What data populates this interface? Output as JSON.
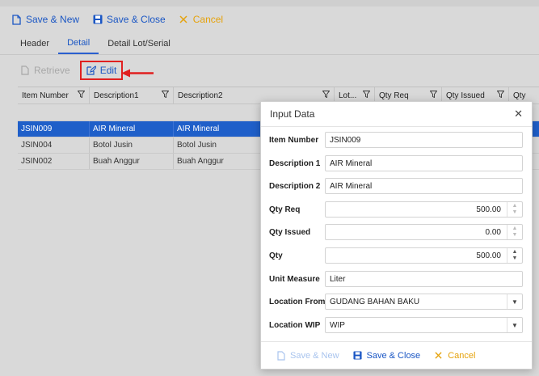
{
  "toolbar": {
    "save_new": "Save & New",
    "save_close": "Save & Close",
    "cancel": "Cancel"
  },
  "tabs": [
    "Header",
    "Detail",
    "Detail Lot/Serial"
  ],
  "subtoolbar": {
    "retrieve": "Retrieve",
    "edit": "Edit"
  },
  "grid": {
    "columns": [
      "Item Number",
      "Description1",
      "Description2",
      "Lot...",
      "Qty Req",
      "Qty Issued",
      "Qty"
    ],
    "rows": [
      {
        "item": "JSIN009",
        "desc1": "AIR Mineral",
        "desc2": "AIR Mineral"
      },
      {
        "item": "JSIN004",
        "desc1": "Botol Jusin",
        "desc2": "Botol Jusin"
      },
      {
        "item": "JSIN002",
        "desc1": "Buah Anggur",
        "desc2": "Buah Anggur"
      }
    ]
  },
  "modal": {
    "title": "Input Data",
    "fields": {
      "item_number": {
        "label": "Item Number",
        "value": "JSIN009"
      },
      "description1": {
        "label": "Description 1",
        "value": "AIR Mineral"
      },
      "description2": {
        "label": "Description 2",
        "value": "AIR Mineral"
      },
      "qty_req": {
        "label": "Qty Req",
        "value": "500.00"
      },
      "qty_issued": {
        "label": "Qty Issued",
        "value": "0.00"
      },
      "qty": {
        "label": "Qty",
        "value": "500.00"
      },
      "unit_measure": {
        "label": "Unit Measure",
        "value": "Liter"
      },
      "location_from": {
        "label": "Location From",
        "value": "GUDANG BAHAN BAKU"
      },
      "location_wip": {
        "label": "Location WIP",
        "value": "WIP"
      }
    },
    "footer": {
      "save_new": "Save & New",
      "save_close": "Save & Close",
      "cancel": "Cancel"
    }
  },
  "colors": {
    "accent": "#1a56c4",
    "cancel": "#e5a20b",
    "selected_row": "#1f5fc9",
    "highlight": "#e02020"
  },
  "icons": [
    "new-document-icon",
    "save-icon",
    "close-x-icon",
    "document-icon",
    "edit-icon",
    "filter-icon",
    "close-icon",
    "chevron-down-icon",
    "spinner-arrows-icon",
    "red-arrow"
  ]
}
